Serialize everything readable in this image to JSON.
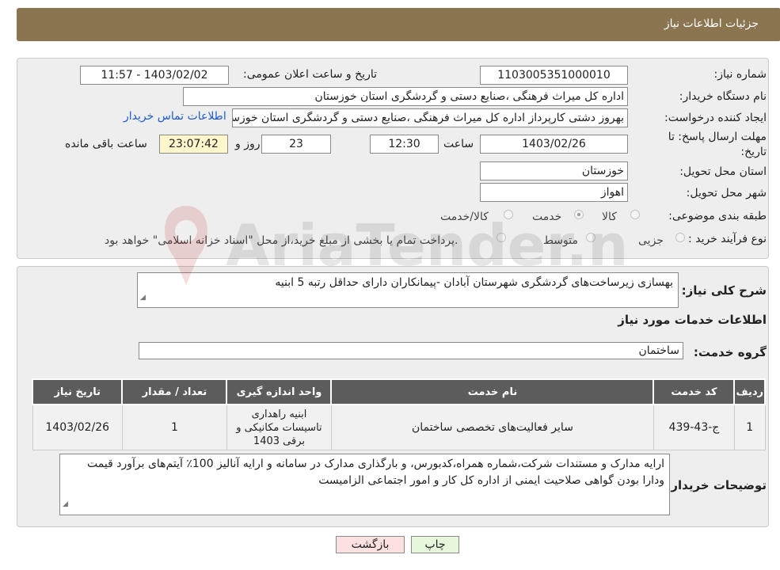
{
  "header": {
    "title": "جزئیات اطلاعات نیاز"
  },
  "details": {
    "need_number_label": "شماره نیاز:",
    "need_number": "1103005351000010",
    "announce_label": "تاریخ و ساعت اعلان عمومی:",
    "announce_value": "1403/02/02 - 11:57",
    "buyer_org_label": "نام دستگاه خریدار:",
    "buyer_org": "اداره کل میراث فرهنگی ،صنایع دستی و گردشگری استان خوزستان",
    "requester_label": "ایجاد کننده درخواست:",
    "requester": "بهروز دشتی کارپرداز اداره کل میراث فرهنگی ،صنایع دستی و گردشگری استان خوزستان",
    "contact_link": "اطلاعات تماس خریدار",
    "deadline_label_1": "مهلت ارسال پاسخ: تا",
    "deadline_label_2": "تاریخ:",
    "deadline_date": "1403/02/26",
    "time_label": "ساعت",
    "deadline_time": "12:30",
    "days_value": "23",
    "days_label": "روز و",
    "remaining_time": "23:07:42",
    "remaining_label": "ساعت باقی مانده",
    "province_label": "استان محل تحویل:",
    "province": "خوزستان",
    "city_label": "شهر محل تحویل:",
    "city": "اهواز",
    "category_label": "طبقه بندی موضوعی:",
    "category_options": [
      "کالا",
      "خدمت",
      "کالا/خدمت"
    ],
    "category_selected": "خدمت",
    "process_label": "نوع فرآیند خرید :",
    "process_options": [
      "جزیی",
      "متوسط"
    ],
    "process_note": "پرداخت تمام یا بخشی از مبلغ خرید،از محل \"اسناد خزانه اسلامی\" خواهد بود."
  },
  "description": {
    "label": "شرح کلی نیاز:",
    "value": "بهسازی زیرساخت‌های گردشگری شهرستان آبادان -پیمانکاران  دارای حداقل رتبه 5 ابنیه"
  },
  "services": {
    "section_title": "اطلاعات خدمات مورد نیاز",
    "group_label": "گروه خدمت:",
    "group_value": "ساختمان",
    "columns": [
      "ردیف",
      "کد خدمت",
      "نام خدمت",
      "واحد اندازه گیری",
      "تعداد / مقدار",
      "تاریخ نیاز"
    ],
    "rows": [
      [
        "1",
        "ج-43-439",
        "سایر فعالیت‌های تخصصی ساختمان",
        "ابنیه راهداری تاسیسات مکانیکی و برقی 1403",
        "1",
        "1403/02/26"
      ]
    ]
  },
  "buyer_notes": {
    "label": "توضیحات خریدار:",
    "value": "ارایه مدارک و مستندات شرکت،شماره همراه،کدبورس، و بارگذاری مدارک در سامانه و ارایه آنالیز 100٪ آیتم‌های برآورد قیمت ودارا بودن گواهی صلاحیت ایمنی از اداره کل کار و امور اجتماعی الزامیست"
  },
  "buttons": {
    "print": "چاپ",
    "back": "بازگشت"
  },
  "watermark": {
    "text": "AriaTender.neT"
  },
  "colors": {
    "header": "#8b7550",
    "table_header": "#5c5c5c",
    "back_button": "#fde0e0",
    "print_button": "#e6f7dc",
    "link": "#1a5bd6"
  }
}
